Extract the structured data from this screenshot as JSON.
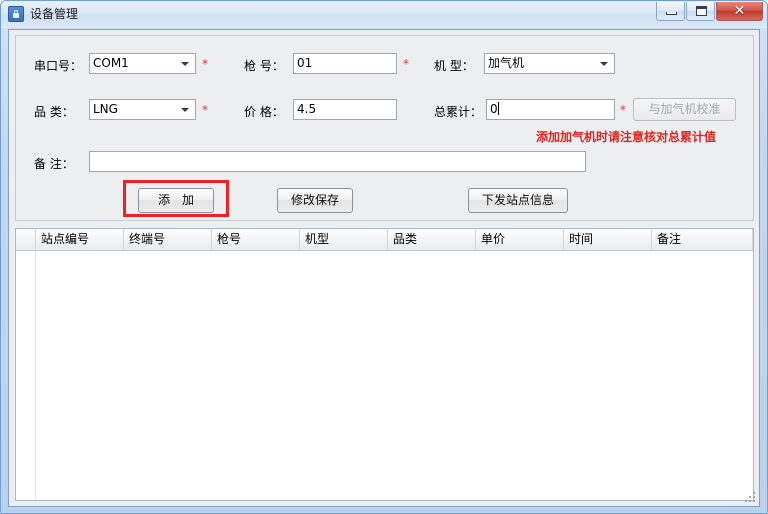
{
  "window": {
    "title": "设备管理",
    "icon": "app-icon",
    "buttons": {
      "minimize": "minimize-icon",
      "maximize": "maximize-icon",
      "close": "✕"
    }
  },
  "form": {
    "fields": {
      "port": {
        "label": "串口号：",
        "value": "COM1",
        "required": "*"
      },
      "gun": {
        "label": "枪 号：",
        "value": "01",
        "required": "*"
      },
      "machine_type": {
        "label": "机 型：",
        "value": "加气机"
      },
      "category": {
        "label": "品 类：",
        "value": "LNG",
        "required": "*"
      },
      "price": {
        "label": "价 格：",
        "value": "4.5"
      },
      "total": {
        "label": "总累计：",
        "value": "0",
        "required": "*"
      },
      "remark": {
        "label": "备 注：",
        "value": ""
      }
    },
    "calibrate_button": "与加气机校准",
    "warning": "添加加气机时请注意核对总累计值",
    "buttons": {
      "add": "添　加",
      "save": "修改保存",
      "dispatch": "下发站点信息"
    }
  },
  "grid": {
    "columns": [
      "站点编号",
      "终端号",
      "枪号",
      "机型",
      "品类",
      "单价",
      "时间",
      "备注"
    ],
    "rows": []
  },
  "colors": {
    "accent": "#3b6fb5",
    "warning": "#e2241e",
    "highlight": "#ee2222",
    "required": "#e03a3a"
  }
}
